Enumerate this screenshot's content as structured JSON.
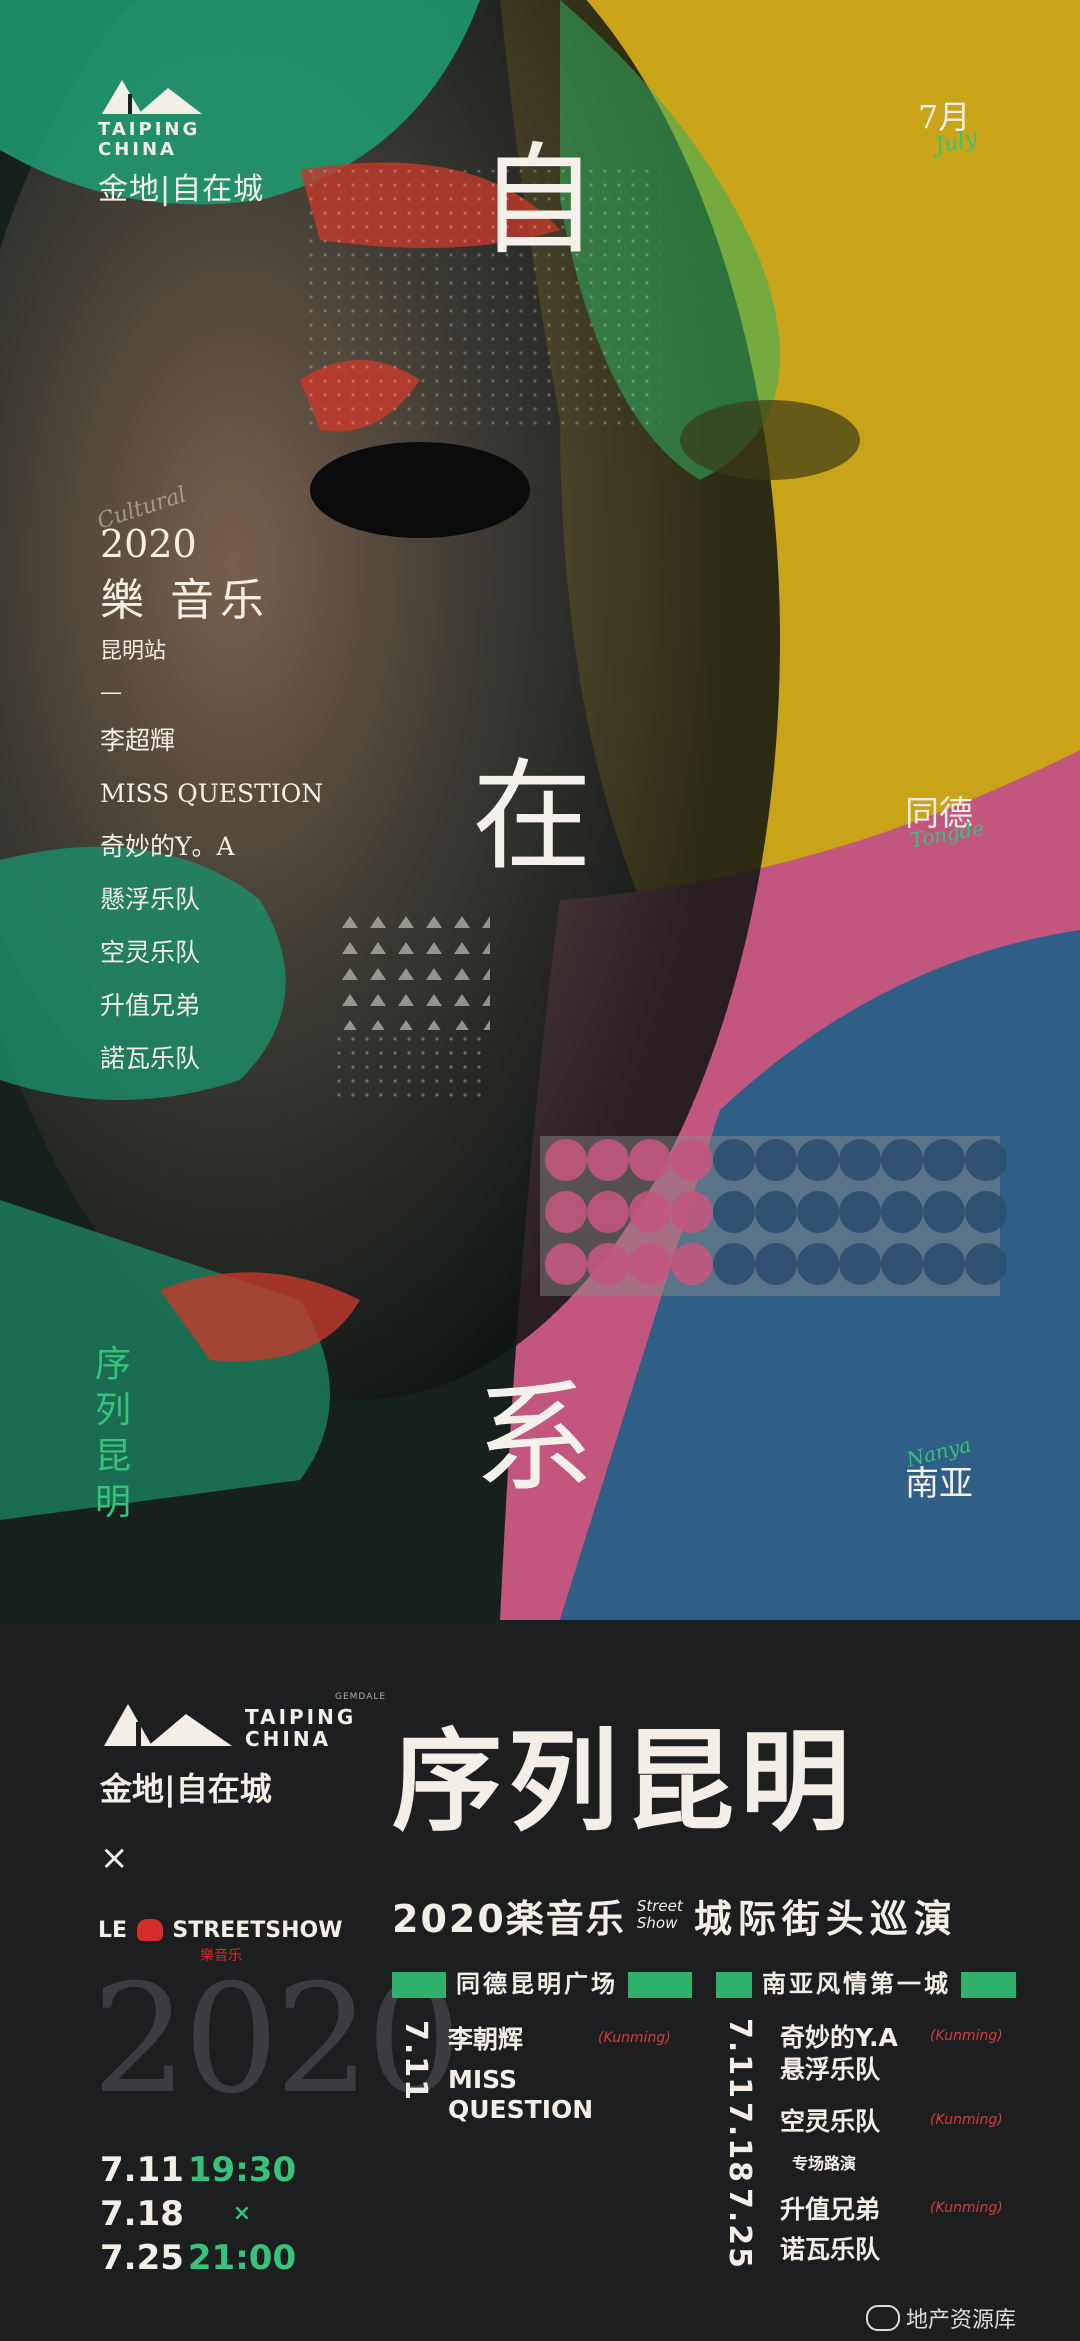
{
  "colors": {
    "green": "#36c27a",
    "yellow": "#c9a419",
    "pink": "#c2567e",
    "blue": "#2f5f86",
    "dark": "#1d1e20",
    "red": "#d42b2b"
  },
  "poster": {
    "logo_en_1": "TAIPING",
    "logo_en_2": "CHINA",
    "logo_cn": "金地|自在城",
    "month": "7月",
    "month_script": "July",
    "big_chars": [
      "自",
      "在",
      "系"
    ],
    "lineup": {
      "script": "Cultural",
      "year": "2020",
      "title": "樂 音乐",
      "station": "昆明站",
      "dash": "—",
      "artists": [
        "李超輝",
        "MISS QUESTION",
        "奇妙的Y。A",
        "懸浮乐队",
        "空灵乐队",
        "升值兄弟",
        "諾瓦乐队"
      ]
    },
    "series_vertical": [
      "序",
      "列",
      "昆",
      "明"
    ],
    "loc_tongde": "同德",
    "loc_tongde_script": "Tongde",
    "loc_nanya": "南亚",
    "loc_nanya_script": "Nanya"
  },
  "panel": {
    "logo_tiny": "GEMDALE",
    "logo_en_1": "TAIPING",
    "logo_en_2": "CHINA",
    "logo_cn": "金地|自在城",
    "times": "×",
    "street_le": "LE",
    "street_show": "STREETSHOW",
    "street_sub": "樂音乐",
    "year_ghost": "2020",
    "dates": [
      "7.11",
      "7.18",
      "7.25"
    ],
    "time_start": "19:30",
    "time_sep": "×",
    "time_end": "21:00",
    "main_title": "序列昆明",
    "sub_a": "2020楽音乐",
    "sub_street": "Street",
    "sub_show": "Show",
    "sub_b": "城际街头巡演",
    "venue_left": "同德昆明广场",
    "venue_right": "南亚风情第一城",
    "left_date": "7.11",
    "left_artist_1": "李朝辉",
    "left_artist_2": "MISS",
    "left_artist_3": "QUESTION",
    "tag": "(Kunming)",
    "right": [
      {
        "date": "7.11",
        "a1": "奇妙的Y.A",
        "a2": "悬浮乐队"
      },
      {
        "date": "7.18",
        "a1": "空灵乐队",
        "a2": "专场路演"
      },
      {
        "date": "7.25",
        "a1": "升值兄弟",
        "a2": "诺瓦乐队"
      }
    ],
    "watermark": "地产资源库"
  }
}
